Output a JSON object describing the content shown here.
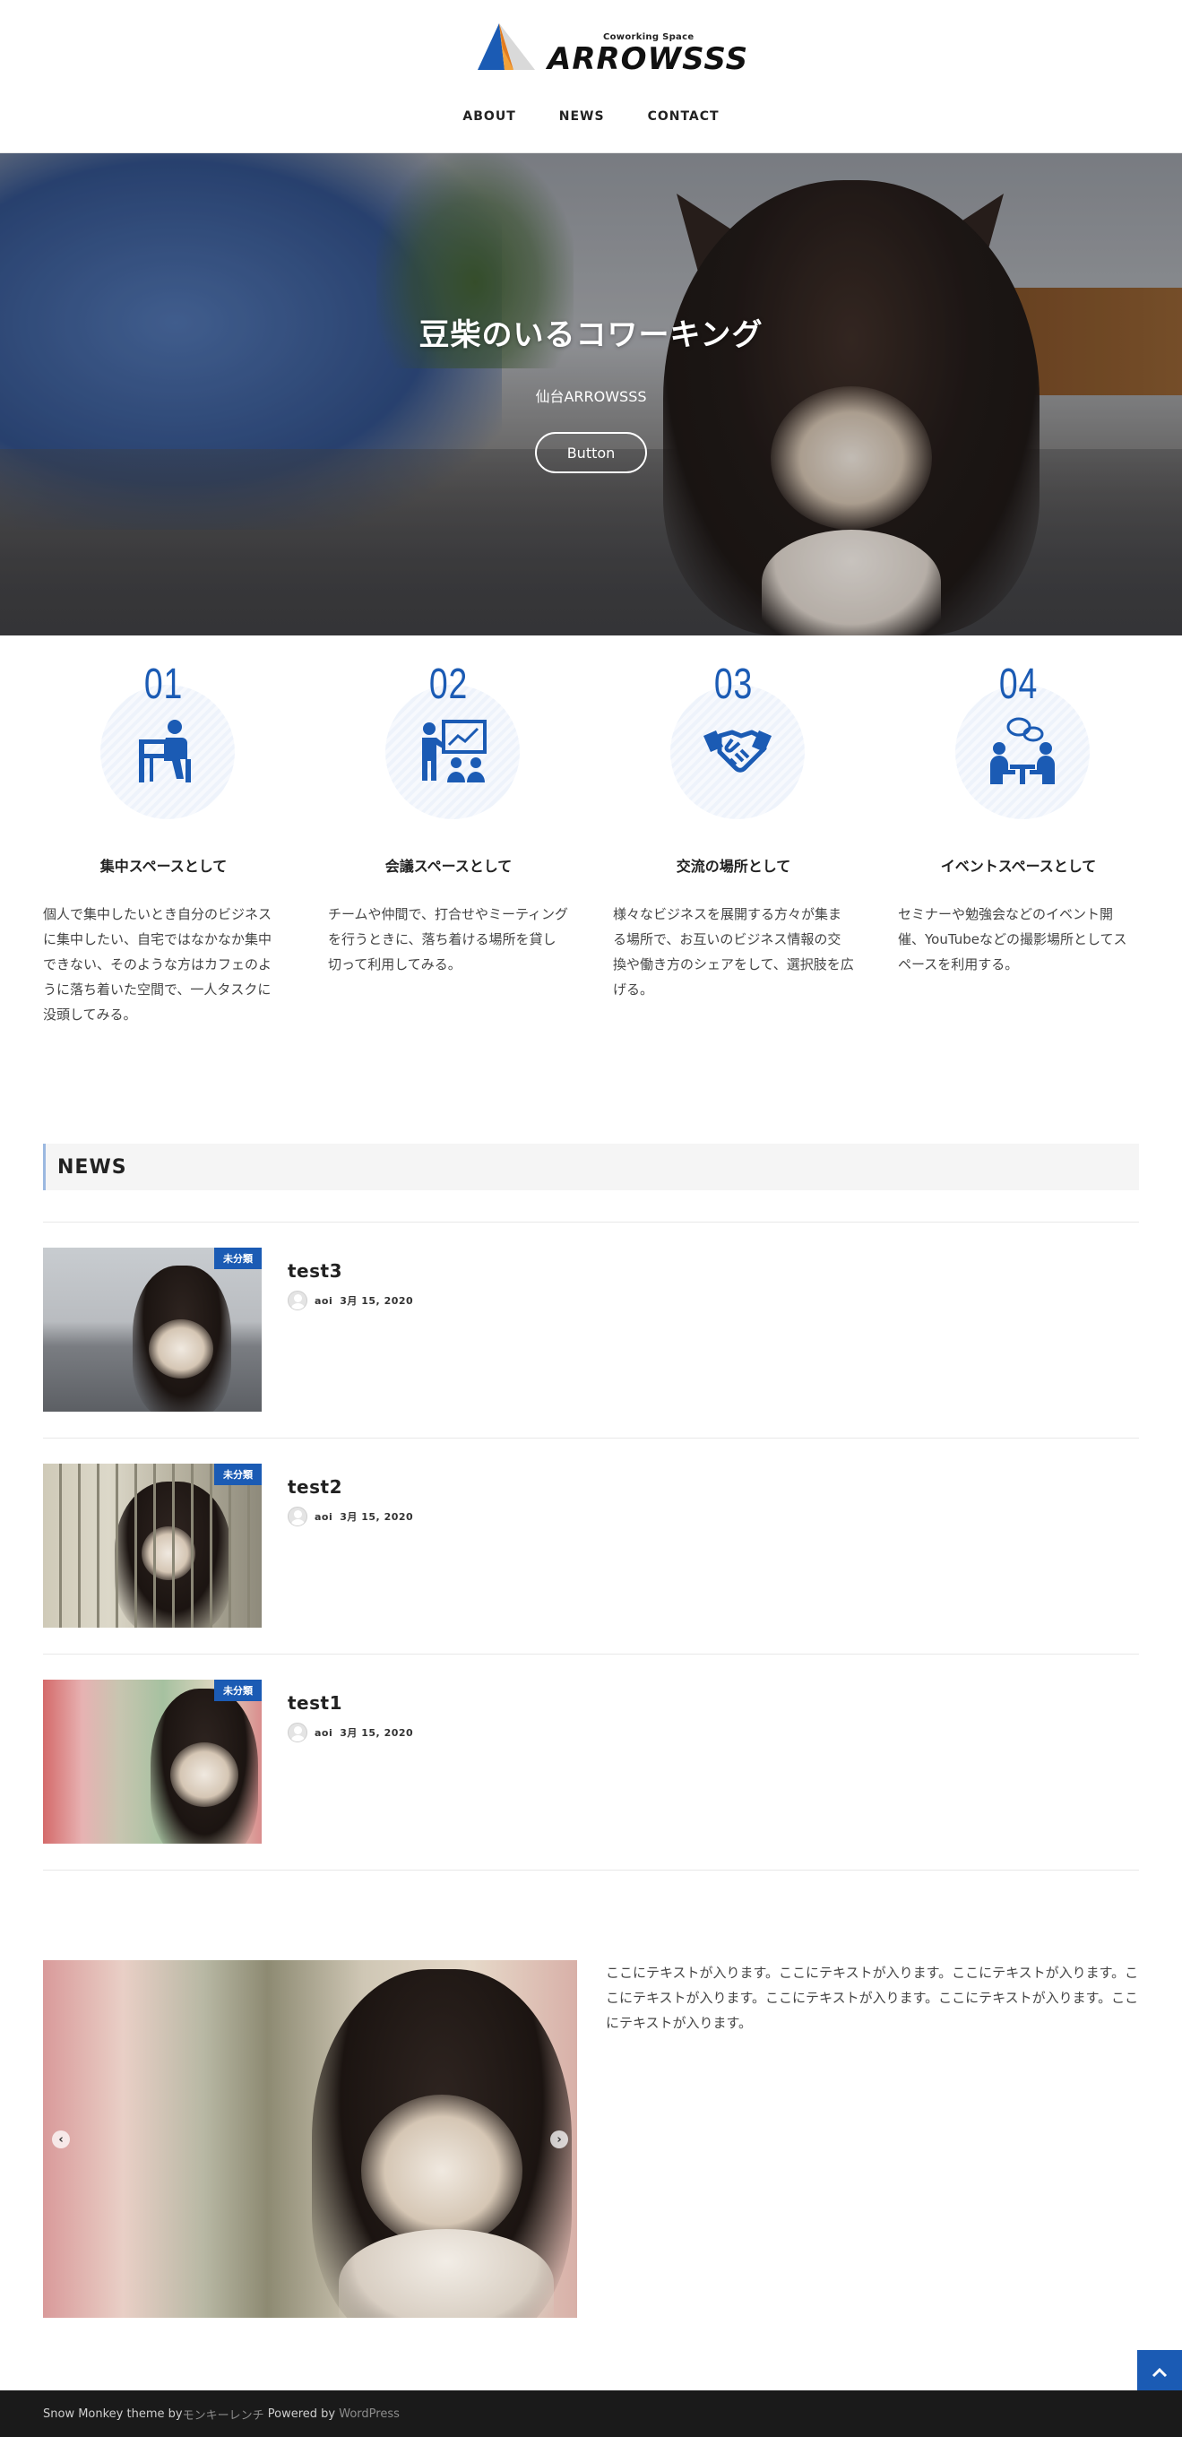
{
  "header": {
    "logo_sub": "Coworking Space",
    "logo_main": "ARROWSSS",
    "nav": [
      "ABOUT",
      "NEWS",
      "CONTACT"
    ]
  },
  "hero": {
    "title": "豆柴のいるコワーキング",
    "subtitle": "仙台ARROWSSS",
    "button": "Button"
  },
  "features": [
    {
      "num": "01",
      "title": "集中スペースとして",
      "desc": "個人で集中したいとき自分のビジネスに集中したい、自宅ではなかなか集中できない、そのような方はカフェのように落ち着いた空間で、一人タスクに没頭してみる。",
      "icon": "desk-worker-icon"
    },
    {
      "num": "02",
      "title": "会議スペースとして",
      "desc": "チームや仲間で、打合せやミーティングを行うときに、落ち着ける場所を貸し切って利用してみる。",
      "icon": "presentation-icon"
    },
    {
      "num": "03",
      "title": "交流の場所として",
      "desc": "様々なビジネスを展開する方々が集まる場所で、お互いのビジネス情報の交換や働き方のシェアをして、選択肢を広げる。",
      "icon": "handshake-icon"
    },
    {
      "num": "04",
      "title": "イベントスペースとして",
      "desc": "セミナーや勉強会などのイベント開催、YouTubeなどの撮影場所としてスペースを利用する。",
      "icon": "meeting-chat-icon"
    }
  ],
  "news": {
    "heading": "NEWS",
    "items": [
      {
        "title": "test3",
        "category": "未分類",
        "author": "aoi",
        "date": "3月 15, 2020"
      },
      {
        "title": "test2",
        "category": "未分類",
        "author": "aoi",
        "date": "3月 15, 2020"
      },
      {
        "title": "test1",
        "category": "未分類",
        "author": "aoi",
        "date": "3月 15, 2020"
      }
    ]
  },
  "slider": {
    "prev": "‹",
    "next": "›",
    "text": "ここにテキストが入ります。ここにテキストが入ります。ここにテキストが入ります。ここにテキストが入ります。ここにテキストが入ります。ここにテキストが入ります。ここにテキストが入ります。"
  },
  "footer": {
    "theme_prefix": "Snow Monkey theme by ",
    "theme_author": "モンキーレンチ",
    "powered_prefix": " Powered by ",
    "powered": "WordPress"
  },
  "colors": {
    "accent": "#1b5bb4",
    "footer_bg": "#1a1a1a"
  }
}
